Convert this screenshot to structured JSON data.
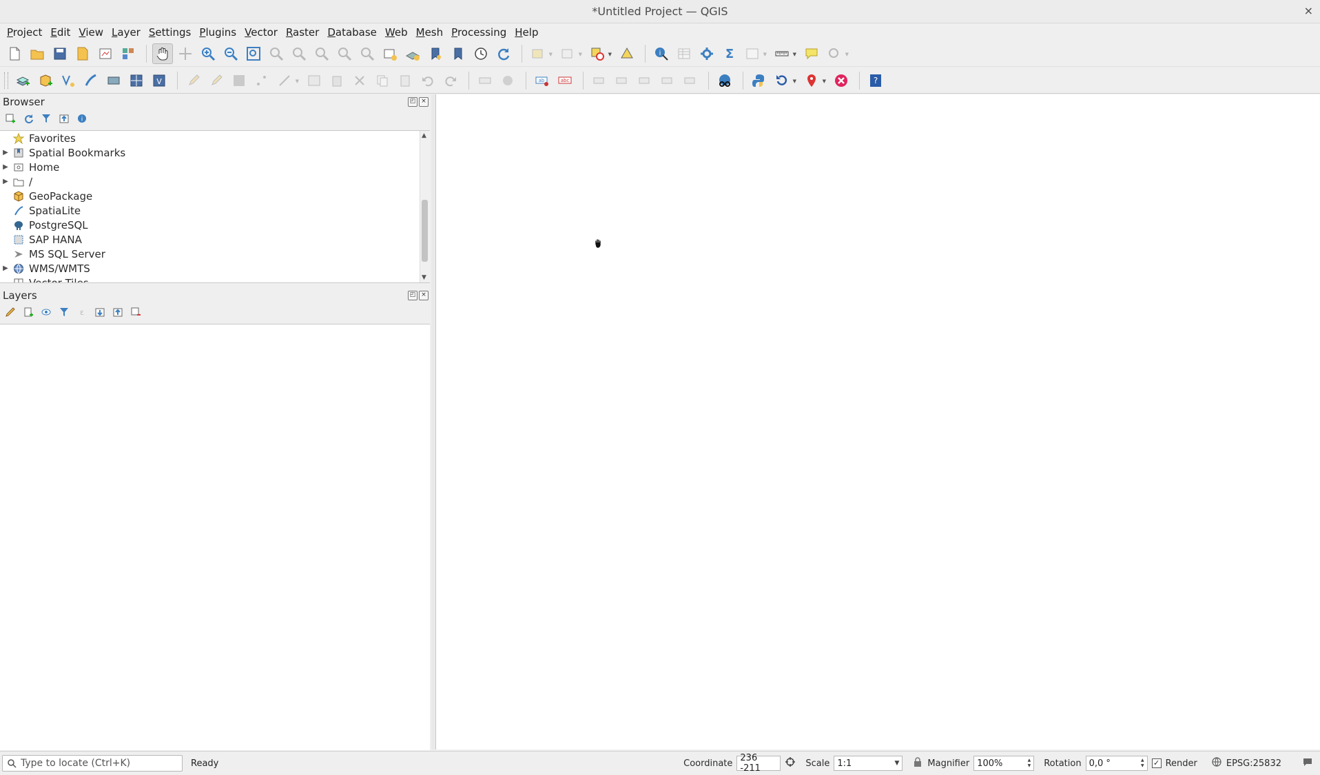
{
  "window": {
    "title": "*Untitled Project — QGIS",
    "close": "×"
  },
  "menu": [
    "Project",
    "Edit",
    "View",
    "Layer",
    "Settings",
    "Plugins",
    "Vector",
    "Raster",
    "Database",
    "Web",
    "Mesh",
    "Processing",
    "Help"
  ],
  "browser": {
    "title": "Browser",
    "items": [
      {
        "label": "Favorites",
        "expandable": false,
        "icon": "star-icon"
      },
      {
        "label": "Spatial Bookmarks",
        "expandable": true,
        "icon": "bookmark-icon"
      },
      {
        "label": "Home",
        "expandable": true,
        "icon": "home-folder-icon"
      },
      {
        "label": "/",
        "expandable": true,
        "icon": "folder-icon"
      },
      {
        "label": "GeoPackage",
        "expandable": false,
        "icon": "geopackage-icon"
      },
      {
        "label": "SpatiaLite",
        "expandable": false,
        "icon": "spatialite-icon"
      },
      {
        "label": "PostgreSQL",
        "expandable": false,
        "icon": "postgresql-icon"
      },
      {
        "label": "SAP HANA",
        "expandable": false,
        "icon": "sap-hana-icon"
      },
      {
        "label": "MS SQL Server",
        "expandable": false,
        "icon": "mssql-icon"
      },
      {
        "label": "WMS/WMTS",
        "expandable": true,
        "icon": "wms-icon"
      },
      {
        "label": "Vector Tiles",
        "expandable": false,
        "icon": "vector-tiles-icon"
      }
    ]
  },
  "layers": {
    "title": "Layers"
  },
  "statusbar": {
    "locator_placeholder": "Type to locate (Ctrl+K)",
    "status": "Ready",
    "coordinate_label": "Coordinate",
    "coordinate_value": "236 -211",
    "scale_label": "Scale",
    "scale_value": "1:1",
    "magnifier_label": "Magnifier",
    "magnifier_value": "100%",
    "rotation_label": "Rotation",
    "rotation_value": "0,0 °",
    "render_label": "Render",
    "render_checked": true,
    "crs": "EPSG:25832"
  },
  "colors": {
    "accent": "#3c7fc1",
    "canvas": "#ffffff",
    "chrome": "#efefef"
  }
}
